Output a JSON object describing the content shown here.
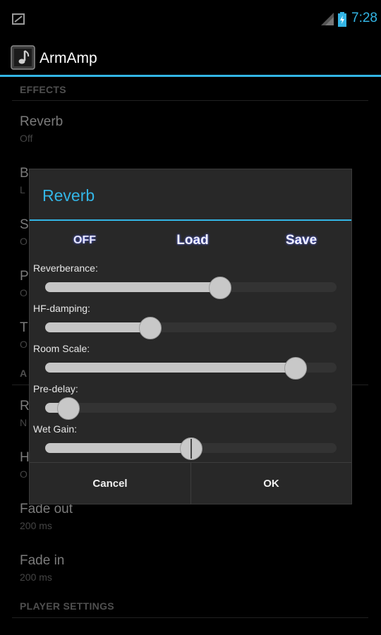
{
  "status_bar": {
    "time": "7:28",
    "notification_icon": "notification-icon",
    "signal_icon": "signal-icon",
    "battery_icon": "battery-charging-icon"
  },
  "app_bar": {
    "title": "ArmAmp",
    "icon": "music-note-icon"
  },
  "colors": {
    "accent": "#33b5e5",
    "dialog_bg": "#282828",
    "background": "#000000"
  },
  "list": {
    "effects_header": "EFFECTS",
    "items": [
      {
        "title": "Reverb",
        "summary": "Off"
      },
      {
        "title": "B",
        "summary": "L"
      },
      {
        "title": "S",
        "summary": "O"
      },
      {
        "title": "P",
        "summary": "O"
      },
      {
        "title": "T",
        "summary": "O"
      }
    ],
    "section2_header": "A",
    "items2": [
      {
        "title": "R",
        "summary": "N"
      },
      {
        "title": "H",
        "summary": "O"
      },
      {
        "title": "Fade out",
        "summary": "200 ms"
      },
      {
        "title": "Fade in",
        "summary": "200 ms"
      }
    ],
    "player_header": "PLAYER SETTINGS"
  },
  "dialog": {
    "title": "Reverb",
    "toolbar": {
      "off": "OFF",
      "load": "Load",
      "save": "Save"
    },
    "sliders": [
      {
        "label": "Reverberance:",
        "value": 0.6
      },
      {
        "label": "HF-damping:",
        "value": 0.36
      },
      {
        "label": "Room Scale:",
        "value": 0.86
      },
      {
        "label": "Pre-delay:",
        "value": 0.08
      },
      {
        "label": "Wet Gain:",
        "value": 0.5
      }
    ],
    "cancel": "Cancel",
    "ok": "OK"
  }
}
